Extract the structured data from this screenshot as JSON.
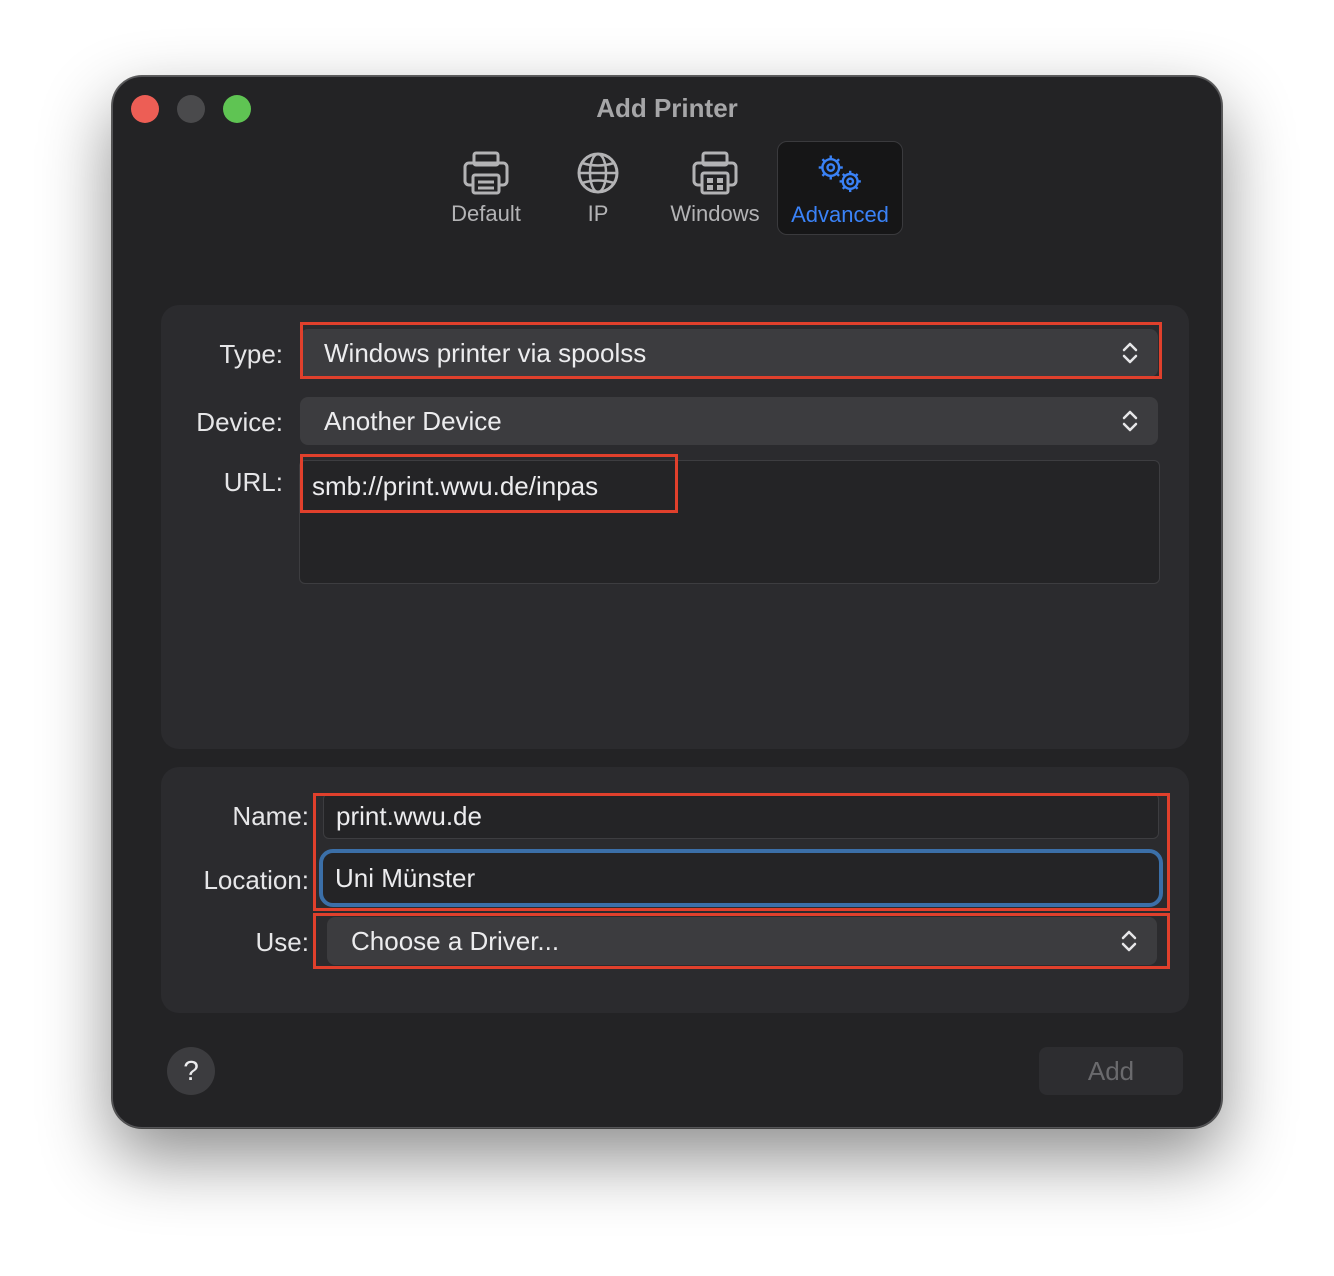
{
  "window": {
    "title": "Add Printer"
  },
  "toolbar": {
    "items": [
      {
        "label": "Default",
        "icon": "printer-icon"
      },
      {
        "label": "IP",
        "icon": "globe-icon"
      },
      {
        "label": "Windows",
        "icon": "windows-printer-icon"
      },
      {
        "label": "Advanced",
        "icon": "gears-icon"
      }
    ],
    "active": "Advanced",
    "accent_color": "#3a82f7"
  },
  "top_panel": {
    "type_label": "Type:",
    "type_value": "Windows printer via spoolss",
    "device_label": "Device:",
    "device_value": "Another Device",
    "url_label": "URL:",
    "url_value": "smb://print.wwu.de/inpas"
  },
  "bottom_panel": {
    "name_label": "Name:",
    "name_value": "print.wwu.de",
    "location_label": "Location:",
    "location_value": "Uni Münster",
    "use_label": "Use:",
    "use_value": "Choose a Driver..."
  },
  "footer": {
    "help_label": "?",
    "add_label": "Add"
  },
  "highlight_color": "#e0402c"
}
